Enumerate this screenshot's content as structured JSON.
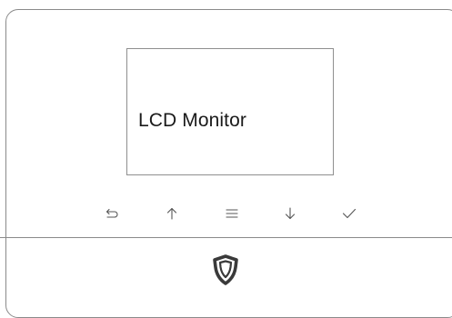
{
  "screen": {
    "label": "LCD Monitor"
  },
  "keys": [
    {
      "icon": "back-icon"
    },
    {
      "icon": "arrow-up-icon"
    },
    {
      "icon": "menu-icon"
    },
    {
      "icon": "arrow-down-icon"
    },
    {
      "icon": "checkmark-icon"
    }
  ],
  "logo": {
    "icon": "shield-logo-icon"
  },
  "colors": {
    "outline": "#8a8a8a",
    "icon": "#555555",
    "logo": "#3a3a3a",
    "text": "#1a1a1a"
  }
}
